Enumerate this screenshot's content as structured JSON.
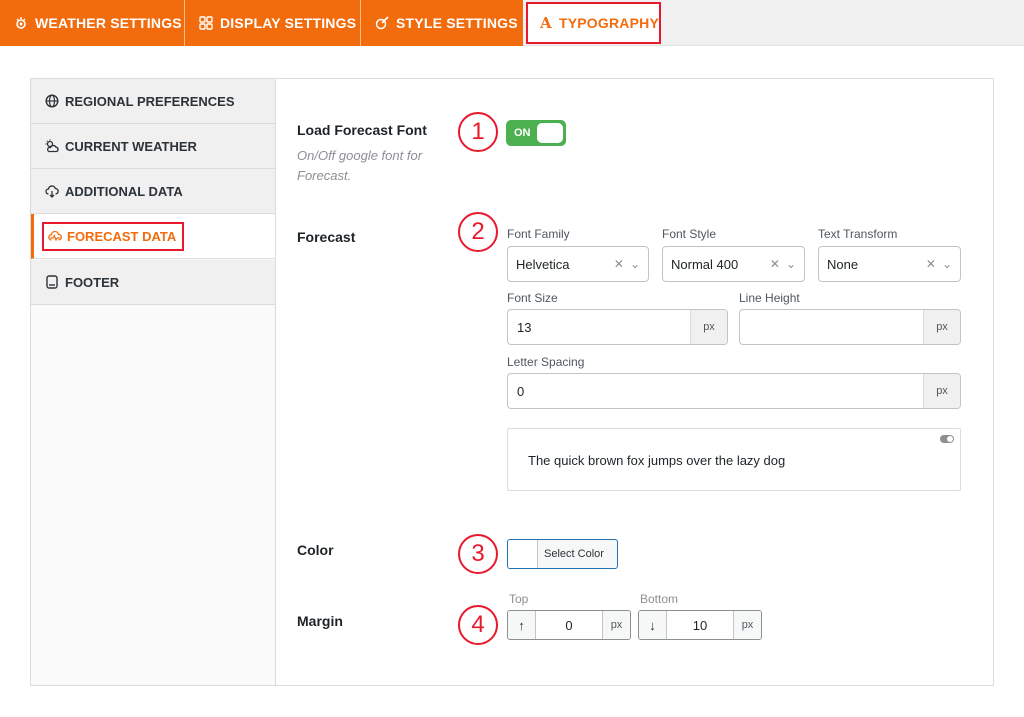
{
  "top_tabs": [
    {
      "label": "WEATHER SETTINGS",
      "icon": "weather-settings-icon"
    },
    {
      "label": "DISPLAY SETTINGS",
      "icon": "grid-icon"
    },
    {
      "label": "STYLE SETTINGS",
      "icon": "brush-icon"
    },
    {
      "label": "TYPOGRAPHY",
      "icon": "typography-icon",
      "active": true
    }
  ],
  "sidebar": {
    "items": [
      {
        "label": "REGIONAL PREFERENCES",
        "icon": "globe-icon"
      },
      {
        "label": "CURRENT WEATHER",
        "icon": "sun-cloud-icon"
      },
      {
        "label": "ADDITIONAL DATA",
        "icon": "cloud-download-icon"
      },
      {
        "label": "FORECAST DATA",
        "icon": "forecast-icon",
        "active": true
      },
      {
        "label": "FOOTER",
        "icon": "footer-icon"
      }
    ]
  },
  "load_font": {
    "label": "Load Forecast Font",
    "description": "On/Off google font for Forecast.",
    "toggle_label": "ON",
    "callout": "1"
  },
  "forecast": {
    "label": "Forecast",
    "callout": "2",
    "font_family": {
      "label": "Font Family",
      "value": "Helvetica"
    },
    "font_style": {
      "label": "Font Style",
      "value": "Normal 400"
    },
    "text_transform": {
      "label": "Text Transform",
      "value": "None"
    },
    "font_size": {
      "label": "Font Size",
      "value": "13",
      "unit": "px"
    },
    "line_height": {
      "label": "Line Height",
      "value": "",
      "unit": "px"
    },
    "letter_spacing": {
      "label": "Letter Spacing",
      "value": "0",
      "unit": "px"
    },
    "preview_text": "The quick brown fox jumps over the lazy dog"
  },
  "color": {
    "label": "Color",
    "callout": "3",
    "button_label": "Select Color"
  },
  "margin": {
    "label": "Margin",
    "callout": "4",
    "top": {
      "label": "Top",
      "value": "0",
      "unit": "px",
      "arrow": "↑"
    },
    "bottom": {
      "label": "Bottom",
      "value": "10",
      "unit": "px",
      "arrow": "↓"
    }
  },
  "colors": {
    "accent": "#f26c0d",
    "highlight": "#e8192c",
    "toggle_on": "#4caf50"
  },
  "select_controls": {
    "clear": "✕",
    "caret": "⌄"
  }
}
